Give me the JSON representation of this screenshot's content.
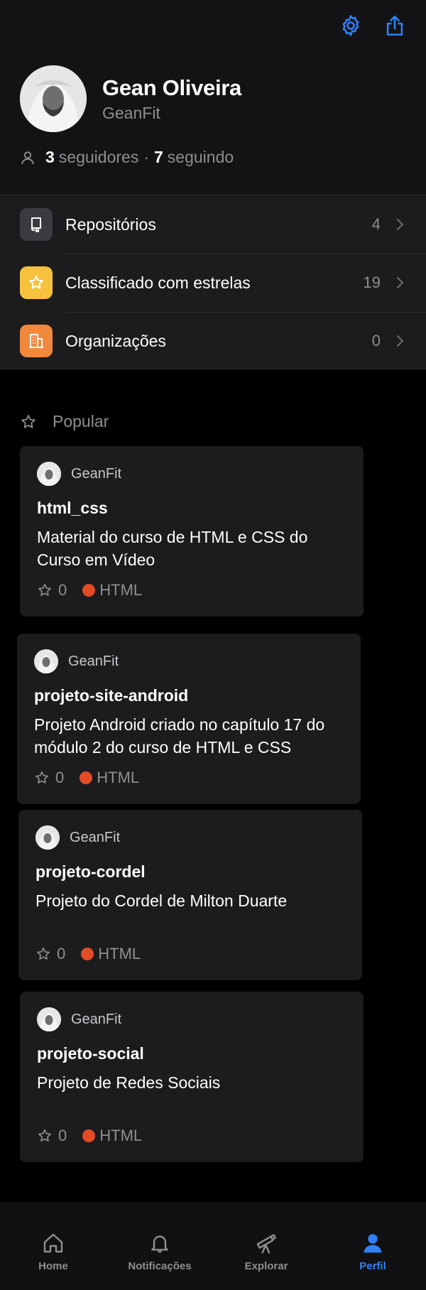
{
  "header": {
    "settings_icon": "gear-icon",
    "share_icon": "share-icon"
  },
  "profile": {
    "name": "Gean Oliveira",
    "handle": "GeanFit",
    "followers_count": "3",
    "followers_label": "seguidores",
    "separator": "·",
    "following_count": "7",
    "following_label": "seguindo"
  },
  "menu": [
    {
      "label": "Repositórios",
      "count": "4",
      "icon": "repo-icon",
      "color": "#3a3a40"
    },
    {
      "label": "Classificado com estrelas",
      "count": "19",
      "icon": "star-icon",
      "color": "#f6c23e"
    },
    {
      "label": "Organizações",
      "count": "0",
      "icon": "building-icon",
      "color": "#f0883e"
    }
  ],
  "popular": {
    "title": "Popular",
    "repos": [
      {
        "owner": "GeanFit",
        "name": "html_css",
        "description": "Material do curso de HTML e CSS do Curso em Vídeo",
        "stars": "0",
        "language": "HTML"
      },
      {
        "owner": "GeanFit",
        "name": "projeto-site-android",
        "description": "Projeto Android criado no capítulo 17 do módulo 2 do curso de HTML e CSS",
        "stars": "0",
        "language": "HTML"
      },
      {
        "owner": "GeanFit",
        "name": "projeto-cordel",
        "description": "Projeto do Cordel de Milton Duarte",
        "stars": "0",
        "language": "HTML"
      },
      {
        "owner": "GeanFit",
        "name": "projeto-social",
        "description": "Projeto de Redes Sociais",
        "stars": "0",
        "language": "HTML"
      }
    ]
  },
  "tabbar": [
    {
      "label": "Home",
      "icon": "home-icon"
    },
    {
      "label": "Notificações",
      "icon": "bell-icon"
    },
    {
      "label": "Explorar",
      "icon": "telescope-icon"
    },
    {
      "label": "Perfil",
      "icon": "person-icon",
      "active": true
    }
  ],
  "colors": {
    "accent": "#2f81f7",
    "html_language": "#e34c26"
  }
}
